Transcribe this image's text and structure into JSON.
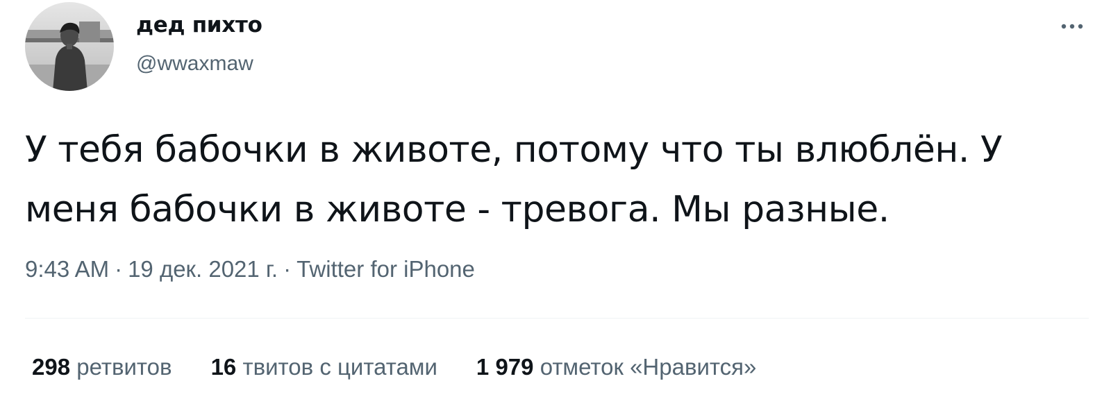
{
  "author": {
    "display_name": "дед пихто",
    "handle": "@wwaxmaw"
  },
  "tweet": {
    "text": "У тебя бабочки в животе, потому что ты влюблён. У меня бабочки в животе - тревога. Мы разные."
  },
  "meta": {
    "time": "9:43 AM",
    "separator": "·",
    "date": "19 дек. 2021 г.",
    "source": "Twitter for iPhone"
  },
  "stats": {
    "retweets": {
      "count": "298",
      "label": "ретвитов"
    },
    "quotes": {
      "count": "16",
      "label": "твитов с цитатами"
    },
    "likes": {
      "count": "1 979",
      "label": "отметок «Нравится»"
    }
  },
  "icons": {
    "more": "more-horizontal-icon",
    "avatar": "profile-photo"
  },
  "colors": {
    "text_primary": "#0f1419",
    "text_secondary": "#536471",
    "divider": "#eff3f4"
  }
}
